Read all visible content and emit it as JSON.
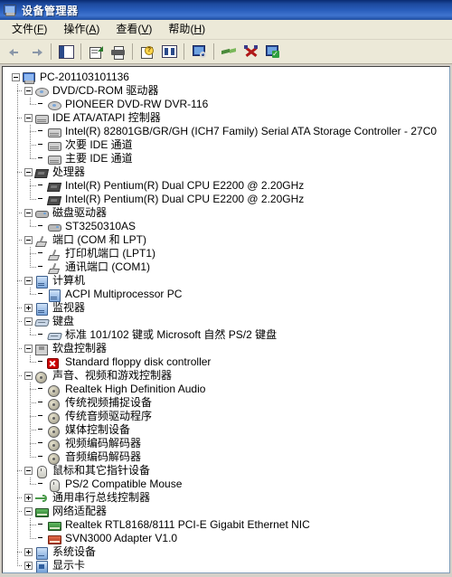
{
  "window": {
    "title": "设备管理器",
    "title_icon": "computer-monitor-icon"
  },
  "menubar": {
    "items": [
      {
        "label": "文件",
        "accel": "F"
      },
      {
        "label": "操作",
        "accel": "A"
      },
      {
        "label": "查看",
        "accel": "V"
      },
      {
        "label": "帮助",
        "accel": "H"
      }
    ]
  },
  "toolbar": {
    "buttons": [
      {
        "name": "back-button",
        "icon": "back-arrow-icon"
      },
      {
        "name": "forward-button",
        "icon": "forward-arrow-icon"
      },
      {
        "name": "show-hide-tree-button",
        "icon": "pane-icon"
      },
      {
        "name": "properties-button",
        "icon": "properties-icon"
      },
      {
        "name": "print-button",
        "icon": "printer-icon"
      },
      {
        "name": "help-button",
        "icon": "help-page-icon"
      },
      {
        "name": "view-button",
        "icon": "two-pane-icon"
      },
      {
        "name": "scan-hardware-changes-button",
        "icon": "scan-monitor-icon"
      },
      {
        "name": "disable-device-button",
        "icon": "green-plug-icon"
      },
      {
        "name": "uninstall-device-button",
        "icon": "red-x-icon"
      },
      {
        "name": "update-driver-button",
        "icon": "monitor-check-icon"
      }
    ]
  },
  "colors": {
    "title_bar_dark": "#0a2c72",
    "title_bar_light": "#3f74cf",
    "menu_bg": "#ece9d8",
    "tree_bg": "#ffffff",
    "error_red": "#cc0000",
    "net_green": "#2e7d32",
    "net_red": "#b03a22"
  },
  "tree": {
    "nodes": [
      {
        "level": 0,
        "expander": "minus",
        "icon": "computer-icon",
        "label": "PC-201103101136"
      },
      {
        "level": 1,
        "expander": "minus",
        "icon": "cd-drive-icon",
        "label": "DVD/CD-ROM 驱动器"
      },
      {
        "level": 2,
        "expander": "none",
        "icon": "cd-drive-icon",
        "label": "PIONEER DVD-RW  DVR-116"
      },
      {
        "level": 1,
        "expander": "minus",
        "icon": "ide-controller-icon",
        "label": "IDE ATA/ATAPI 控制器"
      },
      {
        "level": 2,
        "expander": "none",
        "icon": "ide-controller-icon",
        "label": "Intel(R) 82801GB/GR/GH (ICH7 Family) Serial ATA Storage Controller - 27C0"
      },
      {
        "level": 2,
        "expander": "none",
        "icon": "ide-controller-icon",
        "label": "次要 IDE 通道"
      },
      {
        "level": 2,
        "expander": "none",
        "icon": "ide-controller-icon",
        "label": "主要 IDE 通道"
      },
      {
        "level": 1,
        "expander": "minus",
        "icon": "cpu-icon",
        "label": "处理器"
      },
      {
        "level": 2,
        "expander": "none",
        "icon": "cpu-icon",
        "label": "Intel(R) Pentium(R) Dual  CPU  E2200  @ 2.20GHz"
      },
      {
        "level": 2,
        "expander": "none",
        "icon": "cpu-icon",
        "label": "Intel(R) Pentium(R) Dual  CPU  E2200  @ 2.20GHz"
      },
      {
        "level": 1,
        "expander": "minus",
        "icon": "disk-drive-icon",
        "label": "磁盘驱动器"
      },
      {
        "level": 2,
        "expander": "none",
        "icon": "disk-drive-icon",
        "label": "ST3250310AS"
      },
      {
        "level": 1,
        "expander": "minus",
        "icon": "port-icon",
        "label": "端口 (COM 和 LPT)"
      },
      {
        "level": 2,
        "expander": "none",
        "icon": "port-icon",
        "label": "打印机端口 (LPT1)"
      },
      {
        "level": 2,
        "expander": "none",
        "icon": "port-icon",
        "label": "通讯端口 (COM1)"
      },
      {
        "level": 1,
        "expander": "minus",
        "icon": "computer-node-icon",
        "label": "计算机"
      },
      {
        "level": 2,
        "expander": "none",
        "icon": "computer-node-icon",
        "label": "ACPI Multiprocessor PC"
      },
      {
        "level": 1,
        "expander": "plus",
        "icon": "monitor-icon",
        "label": "监视器"
      },
      {
        "level": 1,
        "expander": "minus",
        "icon": "keyboard-icon",
        "label": "键盘"
      },
      {
        "level": 2,
        "expander": "none",
        "icon": "keyboard-icon",
        "label": "标准 101/102 键或 Microsoft 自然 PS/2 键盘"
      },
      {
        "level": 1,
        "expander": "minus",
        "icon": "floppy-controller-icon",
        "label": "软盘控制器"
      },
      {
        "level": 2,
        "expander": "none",
        "icon": "error-icon",
        "label": "Standard floppy disk controller"
      },
      {
        "level": 1,
        "expander": "minus",
        "icon": "sound-icon",
        "label": "声音、视频和游戏控制器"
      },
      {
        "level": 2,
        "expander": "none",
        "icon": "sound-icon",
        "label": "Realtek High Definition Audio"
      },
      {
        "level": 2,
        "expander": "none",
        "icon": "sound-icon",
        "label": "传统视频捕捉设备"
      },
      {
        "level": 2,
        "expander": "none",
        "icon": "sound-icon",
        "label": "传统音频驱动程序"
      },
      {
        "level": 2,
        "expander": "none",
        "icon": "sound-icon",
        "label": "媒体控制设备"
      },
      {
        "level": 2,
        "expander": "none",
        "icon": "sound-icon",
        "label": "视频编码解码器"
      },
      {
        "level": 2,
        "expander": "none",
        "icon": "sound-icon",
        "label": "音频编码解码器"
      },
      {
        "level": 1,
        "expander": "minus",
        "icon": "mouse-icon",
        "label": "鼠标和其它指针设备"
      },
      {
        "level": 2,
        "expander": "none",
        "icon": "mouse-icon",
        "label": "PS/2 Compatible Mouse"
      },
      {
        "level": 1,
        "expander": "plus",
        "icon": "usb-icon",
        "label": "通用串行总线控制器"
      },
      {
        "level": 1,
        "expander": "minus",
        "icon": "network-adapter-icon",
        "label": "网络适配器"
      },
      {
        "level": 2,
        "expander": "none",
        "icon": "network-adapter-icon",
        "label": "Realtek RTL8168/8111 PCI-E Gigabit Ethernet NIC"
      },
      {
        "level": 2,
        "expander": "none",
        "icon": "network-adapter-red-icon",
        "label": "SVN3000 Adapter V1.0"
      },
      {
        "level": 1,
        "expander": "plus",
        "icon": "system-device-icon",
        "label": "系统设备"
      },
      {
        "level": 1,
        "expander": "plus",
        "icon": "display-adapter-icon",
        "label": "显示卡"
      }
    ]
  }
}
